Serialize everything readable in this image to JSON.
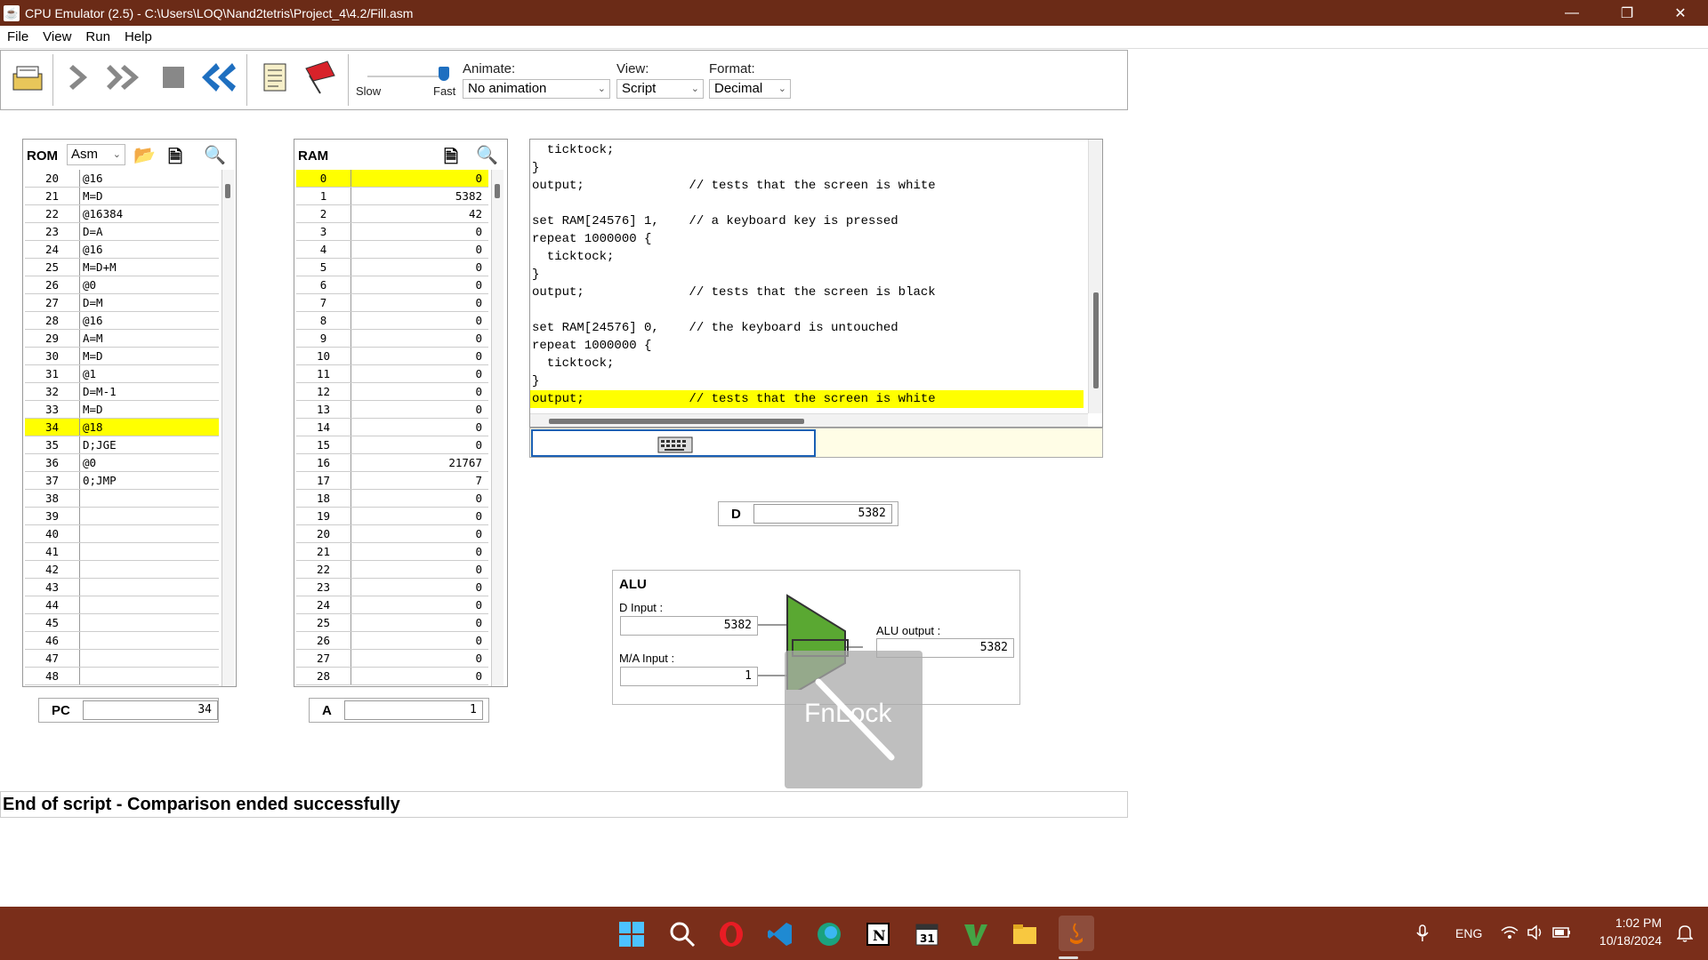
{
  "window": {
    "title": "CPU Emulator (2.5) - C:\\Users\\LOQ\\Nand2tetris\\Project_4\\4.2/Fill.asm"
  },
  "menu": [
    "File",
    "View",
    "Run",
    "Help"
  ],
  "toolbar": {
    "slider": {
      "slow_label": "Slow",
      "fast_label": "Fast",
      "speed_fraction": 0.95
    },
    "animate": {
      "label": "Animate:",
      "value": "No animation"
    },
    "view": {
      "label": "View:",
      "value": "Script"
    },
    "format": {
      "label": "Format:",
      "value": "Decimal"
    }
  },
  "rom": {
    "title": "ROM",
    "mode": "Asm",
    "rows": [
      {
        "addr": "20",
        "instr": "@16"
      },
      {
        "addr": "21",
        "instr": "M=D"
      },
      {
        "addr": "22",
        "instr": "@16384"
      },
      {
        "addr": "23",
        "instr": "D=A"
      },
      {
        "addr": "24",
        "instr": "@16"
      },
      {
        "addr": "25",
        "instr": "M=D+M"
      },
      {
        "addr": "26",
        "instr": "@0"
      },
      {
        "addr": "27",
        "instr": "D=M"
      },
      {
        "addr": "28",
        "instr": "@16"
      },
      {
        "addr": "29",
        "instr": "A=M"
      },
      {
        "addr": "30",
        "instr": "M=D"
      },
      {
        "addr": "31",
        "instr": "@1"
      },
      {
        "addr": "32",
        "instr": "D=M-1"
      },
      {
        "addr": "33",
        "instr": "M=D"
      },
      {
        "addr": "34",
        "instr": "@18"
      },
      {
        "addr": "35",
        "instr": "D;JGE"
      },
      {
        "addr": "36",
        "instr": "@0"
      },
      {
        "addr": "37",
        "instr": "0;JMP"
      },
      {
        "addr": "38",
        "instr": ""
      },
      {
        "addr": "39",
        "instr": ""
      },
      {
        "addr": "40",
        "instr": ""
      },
      {
        "addr": "41",
        "instr": ""
      },
      {
        "addr": "42",
        "instr": ""
      },
      {
        "addr": "43",
        "instr": ""
      },
      {
        "addr": "44",
        "instr": ""
      },
      {
        "addr": "45",
        "instr": ""
      },
      {
        "addr": "46",
        "instr": ""
      },
      {
        "addr": "47",
        "instr": ""
      },
      {
        "addr": "48",
        "instr": ""
      }
    ],
    "highlight_addr": "34"
  },
  "ram": {
    "title": "RAM",
    "rows": [
      {
        "addr": "0",
        "val": "0"
      },
      {
        "addr": "1",
        "val": "5382"
      },
      {
        "addr": "2",
        "val": "42"
      },
      {
        "addr": "3",
        "val": "0"
      },
      {
        "addr": "4",
        "val": "0"
      },
      {
        "addr": "5",
        "val": "0"
      },
      {
        "addr": "6",
        "val": "0"
      },
      {
        "addr": "7",
        "val": "0"
      },
      {
        "addr": "8",
        "val": "0"
      },
      {
        "addr": "9",
        "val": "0"
      },
      {
        "addr": "10",
        "val": "0"
      },
      {
        "addr": "11",
        "val": "0"
      },
      {
        "addr": "12",
        "val": "0"
      },
      {
        "addr": "13",
        "val": "0"
      },
      {
        "addr": "14",
        "val": "0"
      },
      {
        "addr": "15",
        "val": "0"
      },
      {
        "addr": "16",
        "val": "21767"
      },
      {
        "addr": "17",
        "val": "7"
      },
      {
        "addr": "18",
        "val": "0"
      },
      {
        "addr": "19",
        "val": "0"
      },
      {
        "addr": "20",
        "val": "0"
      },
      {
        "addr": "21",
        "val": "0"
      },
      {
        "addr": "22",
        "val": "0"
      },
      {
        "addr": "23",
        "val": "0"
      },
      {
        "addr": "24",
        "val": "0"
      },
      {
        "addr": "25",
        "val": "0"
      },
      {
        "addr": "26",
        "val": "0"
      },
      {
        "addr": "27",
        "val": "0"
      },
      {
        "addr": "28",
        "val": "0"
      }
    ],
    "highlight_addr": "0"
  },
  "registers": {
    "pc": {
      "label": "PC",
      "value": "34"
    },
    "a": {
      "label": "A",
      "value": "1"
    },
    "d": {
      "label": "D",
      "value": "5382"
    }
  },
  "script": {
    "lines": [
      "  ticktock;",
      "}",
      "output;              // tests that the screen is white",
      "",
      "set RAM[24576] 1,    // a keyboard key is pressed",
      "repeat 1000000 {",
      "  ticktock;",
      "}",
      "output;              // tests that the screen is black",
      "",
      "set RAM[24576] 0,    // the keyboard is untouched",
      "repeat 1000000 {",
      "  ticktock;",
      "}",
      "output;              // tests that the screen is white"
    ],
    "highlight_index": 14
  },
  "alu": {
    "title": "ALU",
    "d_input_label": "D Input :",
    "d_input": "5382",
    "ma_input_label": "M/A Input :",
    "ma_input": "1",
    "output_label": "ALU output :",
    "output": "5382"
  },
  "overlay": {
    "text": "FnLock"
  },
  "status": {
    "message": "End of script - Comparison ended successfully"
  },
  "taskbar": {
    "lang": "ENG",
    "time": "1:02 PM",
    "date": "10/18/2024",
    "apps": [
      "windows-start-icon",
      "search-icon",
      "opera-icon",
      "vscode-icon",
      "edge-icon",
      "notion-icon",
      "calendar-icon",
      "vim-icon",
      "file-explorer-icon",
      "java-icon"
    ]
  },
  "colors": {
    "titlebar": "#6b2b17",
    "taskbar": "#7a2e1a",
    "highlight": "#ffff00",
    "alu_green": "#5aa832"
  }
}
